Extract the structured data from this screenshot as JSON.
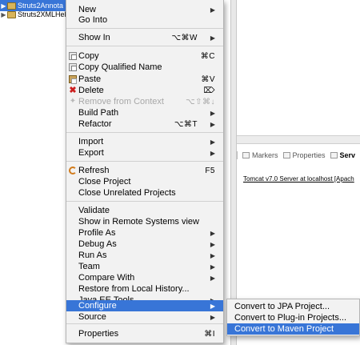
{
  "explorer": {
    "items": [
      {
        "label": "Struts2Annota"
      },
      {
        "label": "Struts2XMLHel"
      }
    ]
  },
  "views": {
    "tabs": [
      {
        "label": "Markers"
      },
      {
        "label": "Properties"
      },
      {
        "label": "Serv"
      }
    ],
    "server_entry": "Tomcat v7.0 Server at localhost [Apach"
  },
  "context_menu": {
    "items": [
      {
        "label": "New",
        "shortcut": "",
        "submenu": true
      },
      {
        "label": "Go Into",
        "shortcut": "",
        "submenu": false
      },
      {
        "label": "Show In",
        "shortcut": "⌥⌘W",
        "submenu": true
      },
      {
        "label": "Copy",
        "shortcut": "⌘C",
        "submenu": false,
        "icon": "copy-icon"
      },
      {
        "label": "Copy Qualified Name",
        "shortcut": "",
        "submenu": false,
        "icon": "copy-icon"
      },
      {
        "label": "Paste",
        "shortcut": "⌘V",
        "submenu": false,
        "icon": "paste-icon"
      },
      {
        "label": "Delete",
        "shortcut": "⌦",
        "submenu": false,
        "icon": "delete-icon"
      },
      {
        "label": "Remove from Context",
        "shortcut": "⌥⇧⌘↓",
        "submenu": false,
        "icon": "remove-context-icon",
        "disabled": true
      },
      {
        "label": "Build Path",
        "shortcut": "",
        "submenu": true
      },
      {
        "label": "Refactor",
        "shortcut": "⌥⌘T",
        "submenu": true
      },
      {
        "label": "Import",
        "shortcut": "",
        "submenu": true
      },
      {
        "label": "Export",
        "shortcut": "",
        "submenu": true
      },
      {
        "label": "Refresh",
        "shortcut": "F5",
        "submenu": false,
        "icon": "refresh-icon"
      },
      {
        "label": "Close Project",
        "shortcut": "",
        "submenu": false
      },
      {
        "label": "Close Unrelated Projects",
        "shortcut": "",
        "submenu": false
      },
      {
        "label": "Validate",
        "shortcut": "",
        "submenu": false
      },
      {
        "label": "Show in Remote Systems view",
        "shortcut": "",
        "submenu": false
      },
      {
        "label": "Profile As",
        "shortcut": "",
        "submenu": true
      },
      {
        "label": "Debug As",
        "shortcut": "",
        "submenu": true
      },
      {
        "label": "Run As",
        "shortcut": "",
        "submenu": true
      },
      {
        "label": "Team",
        "shortcut": "",
        "submenu": true
      },
      {
        "label": "Compare With",
        "shortcut": "",
        "submenu": true
      },
      {
        "label": "Restore from Local History...",
        "shortcut": "",
        "submenu": false
      },
      {
        "label": "Java EE Tools",
        "shortcut": "",
        "submenu": true
      },
      {
        "label": "Configure",
        "shortcut": "",
        "submenu": true,
        "highlighted": true
      },
      {
        "label": "Source",
        "shortcut": "",
        "submenu": true
      },
      {
        "label": "Properties",
        "shortcut": "⌘I",
        "submenu": false
      }
    ]
  },
  "configure_submenu": {
    "items": [
      {
        "label": "Convert to JPA Project..."
      },
      {
        "label": "Convert to Plug-in Projects..."
      },
      {
        "label": "Convert to Maven Project",
        "highlighted": true
      }
    ]
  },
  "colors": {
    "selection": "#3875d7",
    "menu_background": "#f2f2f2",
    "delete_icon": "#cc1f1f"
  }
}
